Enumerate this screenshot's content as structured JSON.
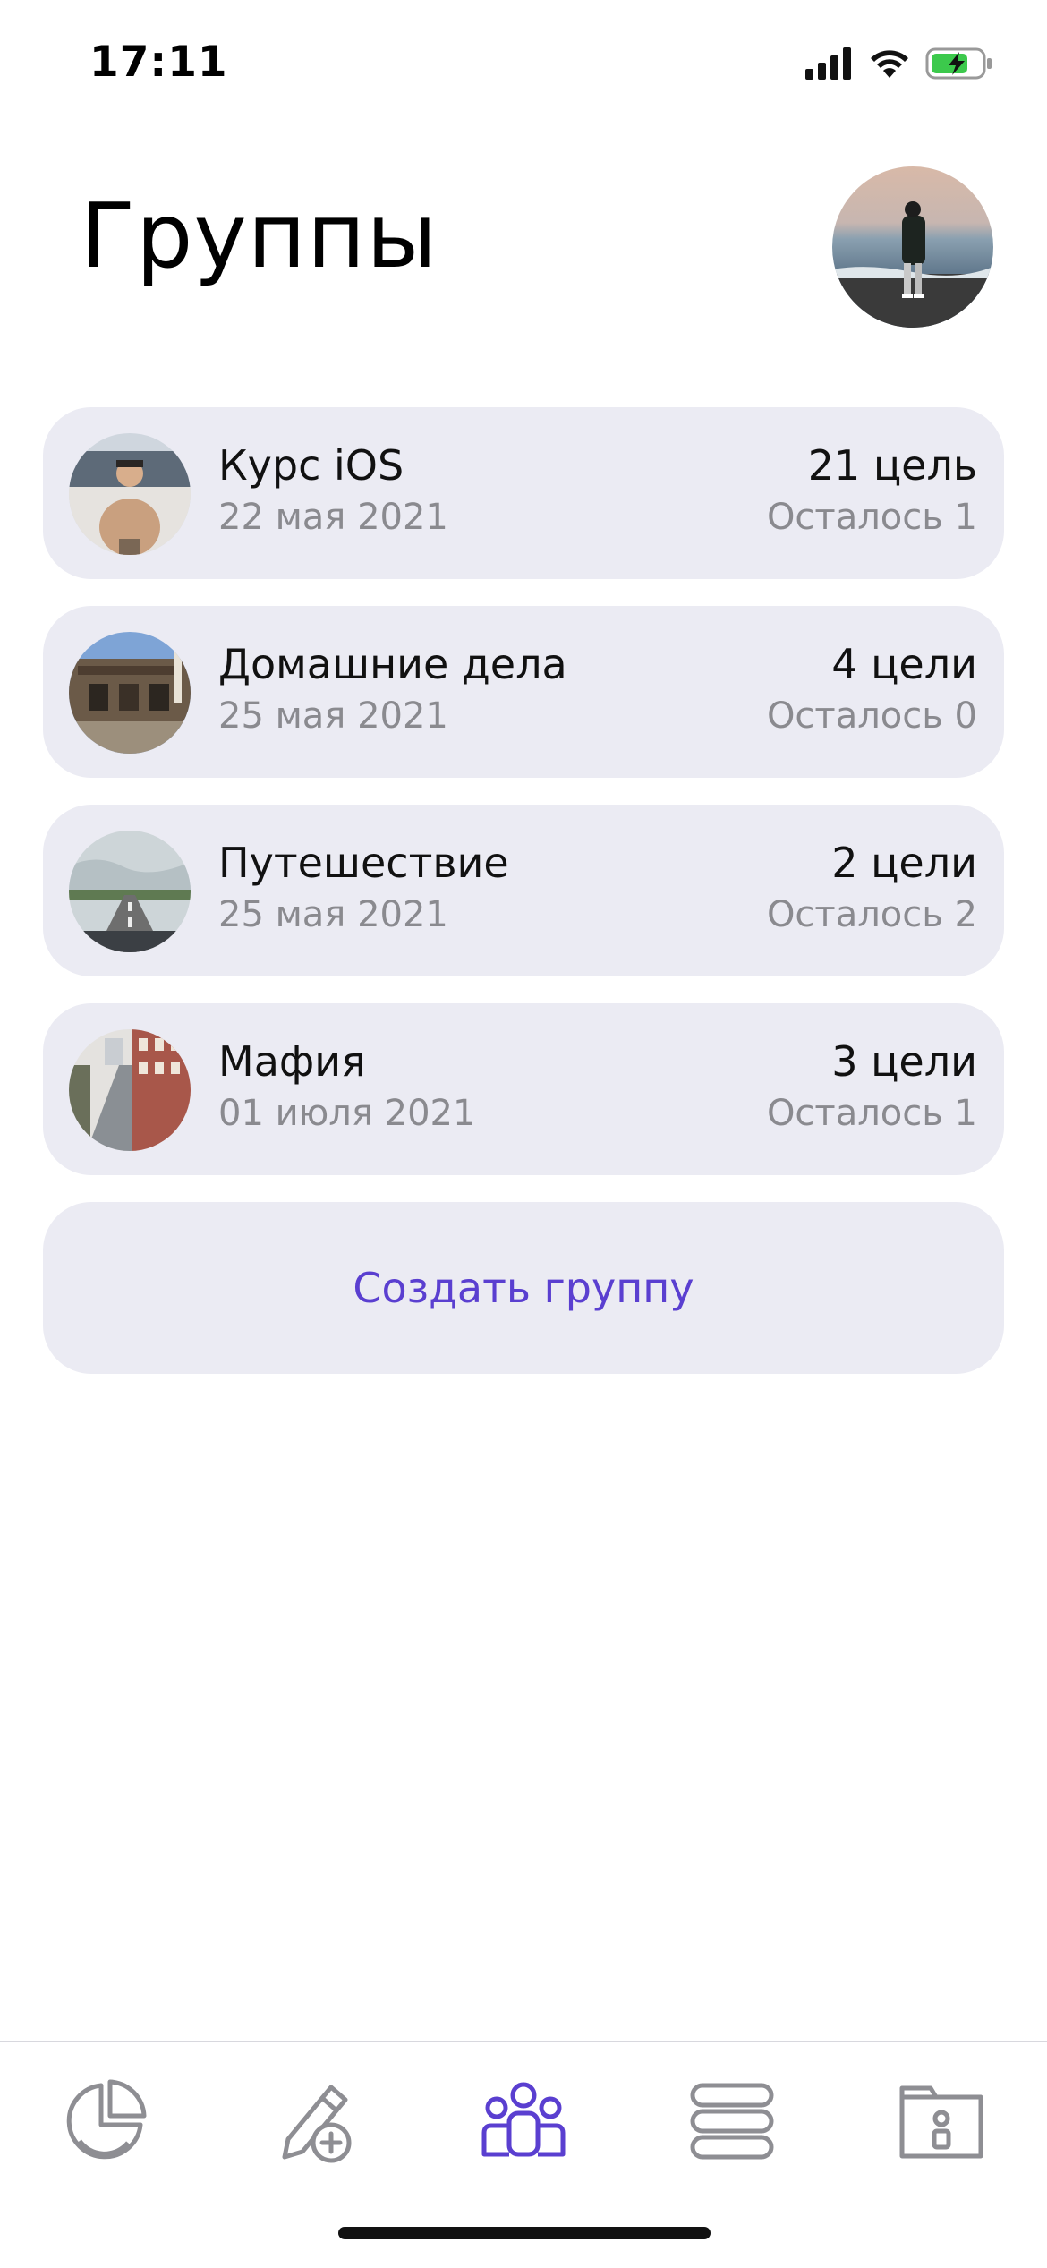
{
  "status_bar": {
    "time": "17:11"
  },
  "header": {
    "title": "Группы"
  },
  "groups": [
    {
      "name": "Курс iOS",
      "date": "22 мая 2021",
      "goals": "21 цель",
      "remaining": "Осталось 1"
    },
    {
      "name": "Домашние дела",
      "date": "25 мая 2021",
      "goals": "4 цели",
      "remaining": "Осталось 0"
    },
    {
      "name": "Путешествие",
      "date": "25 мая 2021",
      "goals": "2 цели",
      "remaining": "Осталось 2"
    },
    {
      "name": "Мафия",
      "date": "01 июля 2021",
      "goals": "3 цели",
      "remaining": "Осталось 1"
    }
  ],
  "actions": {
    "create_group": "Создать группу"
  },
  "tab_bar": {
    "tabs": [
      {
        "icon": "pie-chart-icon",
        "active": false
      },
      {
        "icon": "edit-add-icon",
        "active": false
      },
      {
        "icon": "group-icon",
        "active": true
      },
      {
        "icon": "list-stack-icon",
        "active": false
      },
      {
        "icon": "folder-profile-icon",
        "active": false
      }
    ]
  },
  "colors": {
    "accent": "#5a3fd0",
    "card_background": "#ebebf3",
    "secondary_text": "#8a8a8f",
    "inactive_icon": "#8e8e93",
    "battery_green": "#3cc94c"
  }
}
